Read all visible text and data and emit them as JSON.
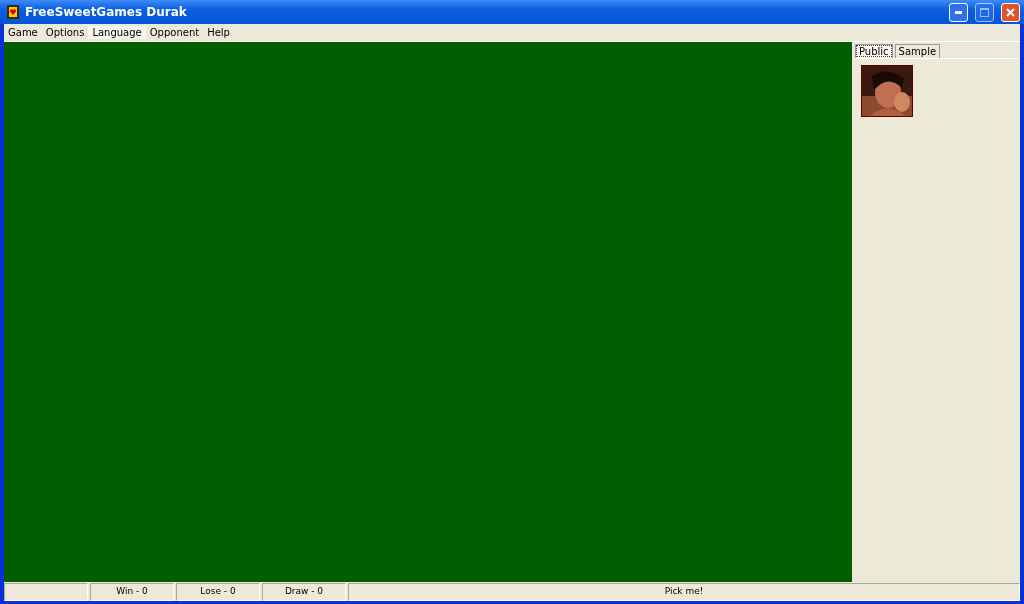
{
  "window": {
    "title": "FreeSweetGames Durak"
  },
  "menu": [
    {
      "label": "Game",
      "selected": false
    },
    {
      "label": "Options",
      "selected": false
    },
    {
      "label": "Language",
      "selected": true
    },
    {
      "label": "Opponent",
      "selected": false
    },
    {
      "label": "Help",
      "selected": false
    }
  ],
  "opponent_panel": {
    "tabs": [
      {
        "label": "Public",
        "selected": true
      },
      {
        "label": "Sample",
        "selected": false
      }
    ]
  },
  "status_bar": [
    "Win - 0",
    "Lose - 0",
    "Draw - 0",
    "Pick me!"
  ]
}
